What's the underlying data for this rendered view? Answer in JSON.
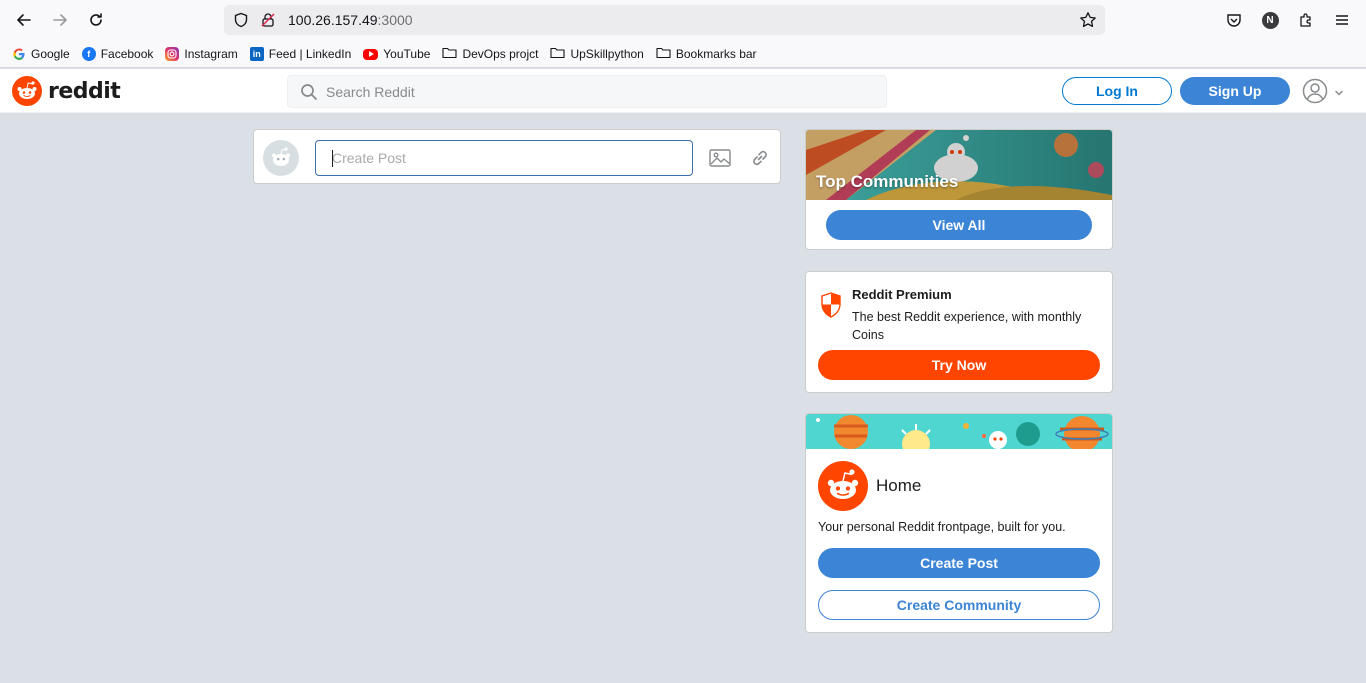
{
  "browser": {
    "url_host": "100.26.157.49",
    "url_port": ":3000",
    "profile_initial": "N",
    "bookmarks": [
      {
        "label": "Google",
        "icon": "google-icon"
      },
      {
        "label": "Facebook",
        "icon": "facebook-icon"
      },
      {
        "label": "Instagram",
        "icon": "instagram-icon"
      },
      {
        "label": "Feed | LinkedIn",
        "icon": "linkedin-icon"
      },
      {
        "label": "YouTube",
        "icon": "youtube-icon"
      },
      {
        "label": "DevOps projct",
        "icon": "folder-icon"
      },
      {
        "label": "UpSkillpython",
        "icon": "folder-icon"
      },
      {
        "label": "Bookmarks bar",
        "icon": "folder-icon"
      }
    ]
  },
  "header": {
    "logo_text": "reddit",
    "search_placeholder": "Search Reddit",
    "login_label": "Log In",
    "signup_label": "Sign Up"
  },
  "create_post": {
    "placeholder": "Create Post"
  },
  "top_communities": {
    "title": "Top Communities",
    "view_all_label": "View All"
  },
  "premium": {
    "title": "Reddit Premium",
    "description": "The best Reddit experience, with monthly Coins",
    "button_label": "Try Now"
  },
  "home": {
    "title": "Home",
    "description": "Your personal Reddit frontpage, built for you.",
    "create_post_label": "Create Post",
    "create_community_label": "Create Community"
  },
  "colors": {
    "brand_orange": "#ff4500",
    "brand_blue": "#3b84d6",
    "background": "#dae0e6"
  }
}
